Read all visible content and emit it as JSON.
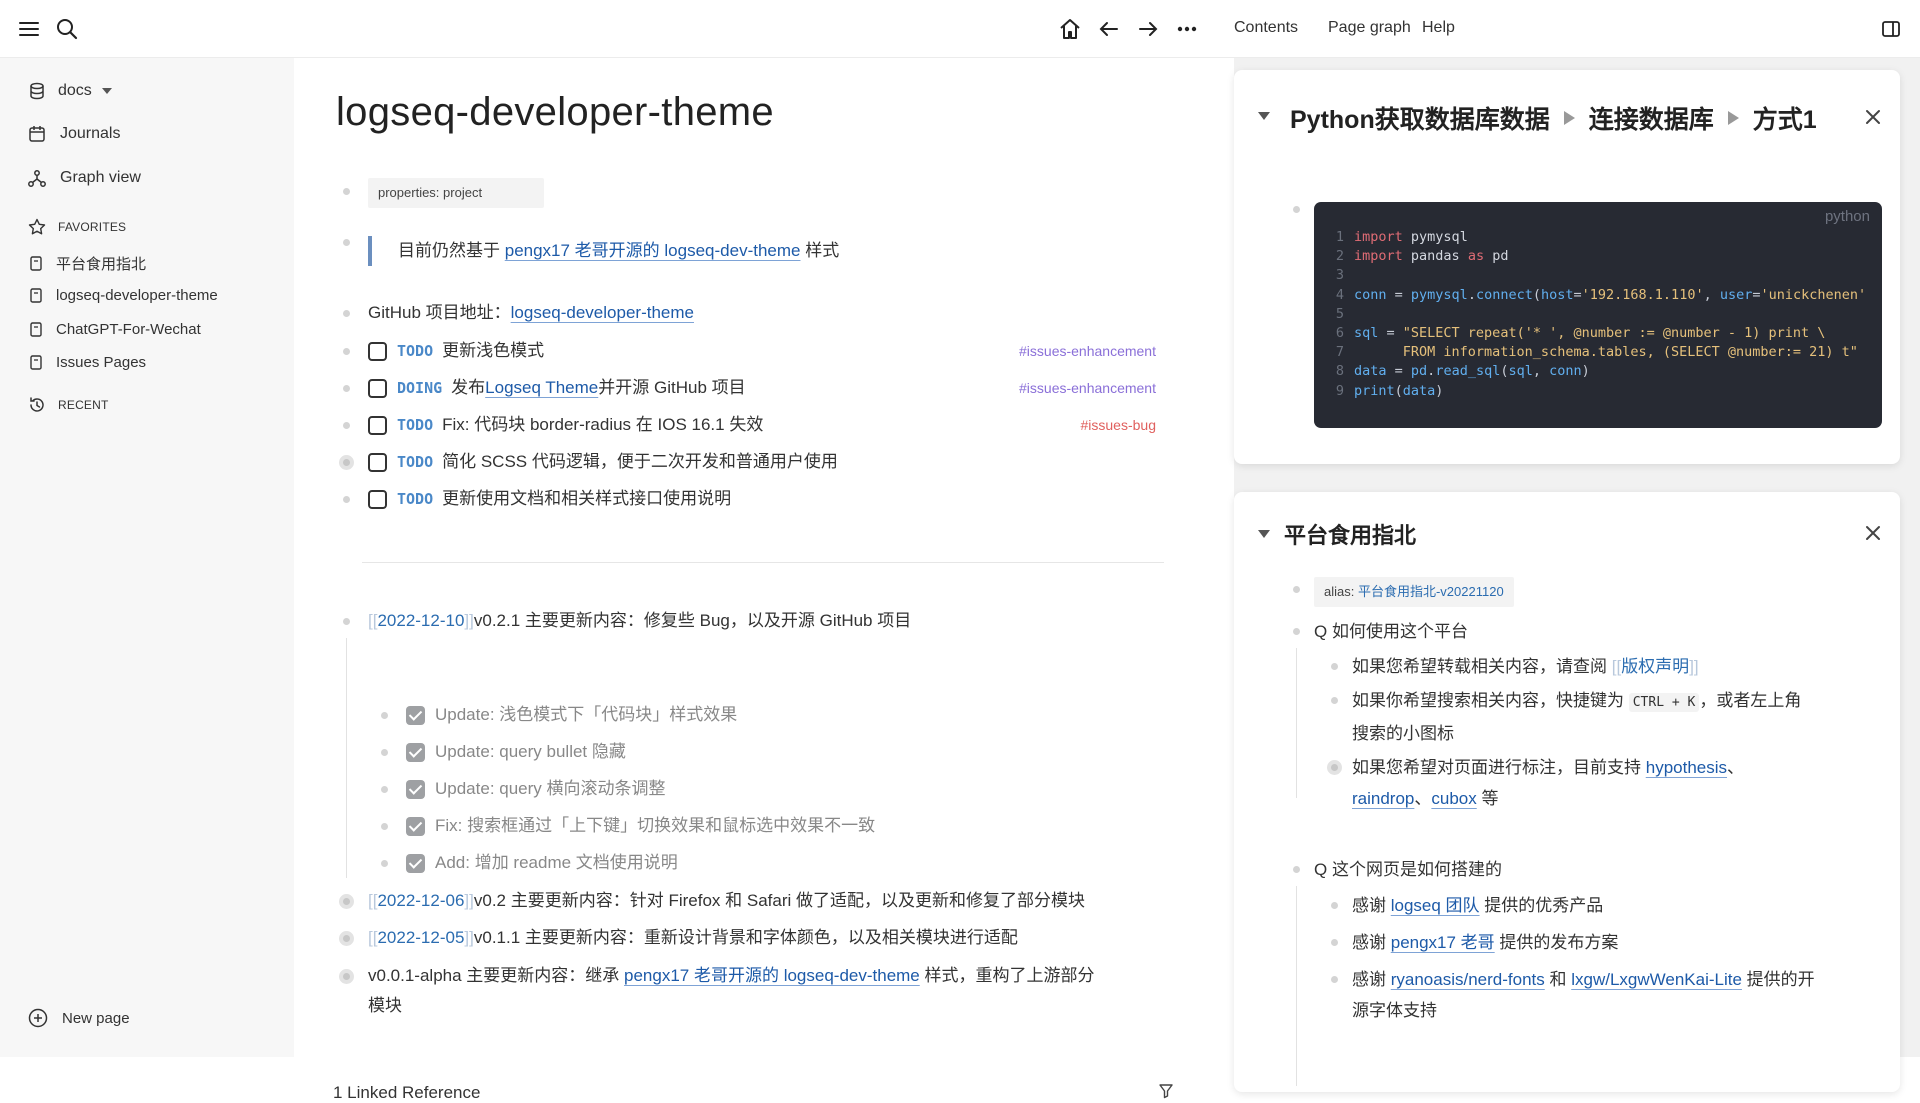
{
  "topbar": {
    "nav_links": [
      "Contents",
      "Page graph",
      "Help"
    ]
  },
  "sidebar": {
    "graph_name": "docs",
    "nav": [
      {
        "label": "Journals",
        "icon": "calendar-icon"
      },
      {
        "label": "Graph view",
        "icon": "graph-icon"
      }
    ],
    "favorites_label": "FAVORITES",
    "favorites": [
      "平台食用指北",
      "logseq-developer-theme",
      "ChatGPT-For-Wechat",
      "Issues Pages"
    ],
    "recent_label": "RECENT",
    "new_page": "New page"
  },
  "page": {
    "title": "logseq-developer-theme",
    "properties": "properties: project",
    "quote_prefix": "目前仍然基于 ",
    "quote_link": "pengx17 老哥开源的 logseq-dev-theme",
    "quote_suffix": " 样式",
    "github_label": "GitHub 项目地址：",
    "github_link": "logseq-developer-theme",
    "tasks": [
      {
        "marker": "TODO",
        "text": "更新浅色模式",
        "tag": "#issues-enhancement",
        "tag_color": "#8a6fd8"
      },
      {
        "marker": "DOING",
        "pre": "发布 ",
        "link": "Logseq Theme",
        "post": " 并开源 GitHub 项目",
        "tag": "#issues-enhancement",
        "tag_color": "#8a6fd8"
      },
      {
        "marker": "TODO",
        "text": "Fix: 代码块 border-radius 在 IOS 16.1 失效",
        "tag": "#issues-bug",
        "tag_color": "#e0605e"
      },
      {
        "marker": "TODO",
        "text": "简化 SCSS 代码逻辑，便于二次开发和普通用户使用"
      },
      {
        "marker": "TODO",
        "text": "更新使用文档和相关样式接口使用说明"
      }
    ],
    "changelog": [
      {
        "date": "2022-12-10",
        "text": " v0.2.1 主要更新内容：修复些 Bug，以及开源 GitHub 项目"
      },
      {
        "date": "2022-12-06",
        "text": " v0.2 主要更新内容：针对 Firefox 和 Safari 做了适配，以及更新和修复了部分模块"
      },
      {
        "date": "2022-12-05",
        "text": " v0.1.1 主要更新内容：重新设计背景和字体颜色，以及相关模块进行适配"
      }
    ],
    "done_items": [
      "Update: 浅色模式下「代码块」样式效果",
      "Update: query bullet 隐藏",
      "Update: query 横向滚动条调整",
      "Fix: 搜索框通过「上下键」切换效果和鼠标选中效果不一致",
      "Add: 增加 readme 文档使用说明"
    ],
    "alpha_prefix": "v0.0.1-alpha 主要更新内容：继承 ",
    "alpha_link": "pengx17 老哥开源的 logseq-dev-theme",
    "alpha_suffix": " 样式，重构了上游部分",
    "alpha_line2": "模块",
    "linked_refs": "1 Linked Reference"
  },
  "right_panel": {
    "card1": {
      "crumbs": [
        "Python获取数据库数据",
        "连接数据库",
        "方式1"
      ],
      "lang": "python"
    },
    "card2": {
      "title": "平台食用指北",
      "alias_label": "alias: ",
      "alias_value": "平台食用指北-v20221120",
      "q1": "Q 如何使用这个平台",
      "q1_a1_pre": "如果您希望转载相关内容，请查阅 ",
      "q1_a1_link": "版权声明",
      "q1_a2_pre": "如果你希望搜索相关内容，快捷键为 ",
      "q1_a2_kbd": "CTRL + K",
      "q1_a2_post": "，或者左上角",
      "q1_a2_line2": "搜索的小图标",
      "q1_a3_pre": "如果您希望对页面进行标注，目前支持 ",
      "q1_a3_link1": "hypothesis",
      "q1_a3_link2": "raindrop",
      "q1_a3_link3": "cubox",
      "q1_a3_post": " 等",
      "q2": "Q 这个网页是如何搭建的",
      "q2_a1_pre": "感谢 ",
      "q2_a1_link": "logseq 团队",
      "q2_a1_post": " 提供的优秀产品",
      "q2_a2_pre": "感谢 ",
      "q2_a2_link": "pengx17 老哥",
      "q2_a2_post": " 提供的发布方案",
      "q2_a3_pre": "感谢 ",
      "q2_a3_link1": "ryanoasis/nerd-fonts",
      "q2_a3_mid": " 和 ",
      "q2_a3_link2": "lxgw/LxgwWenKai-Lite",
      "q2_a3_post": " 提供的开",
      "q2_a3_line2": "源字体支持"
    }
  }
}
